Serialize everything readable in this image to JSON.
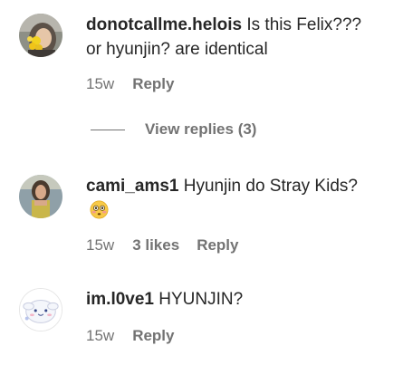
{
  "comments": [
    {
      "username": "donotcallme.helois",
      "text_line1": "Is this Felix???",
      "text_line2": "or hyunjin? are identical",
      "time": "15w",
      "reply_label": "Reply",
      "avatar_icon": "avatar-photo-yellow-flowers"
    },
    {
      "username": "cami_ams1",
      "text": "Hyunjin do Stray Kids?",
      "emoji": "flushed-face-emoji",
      "time": "15w",
      "likes": "3 likes",
      "reply_label": "Reply",
      "avatar_icon": "avatar-photo-person"
    },
    {
      "username": "im.l0ve1",
      "text": "HYUNJIN?",
      "time": "15w",
      "reply_label": "Reply",
      "avatar_icon": "avatar-cartoon-character"
    }
  ],
  "view_replies": {
    "label": "View replies (3)"
  },
  "colors": {
    "text": "#262626",
    "secondary": "#737373",
    "background": "#ffffff"
  }
}
